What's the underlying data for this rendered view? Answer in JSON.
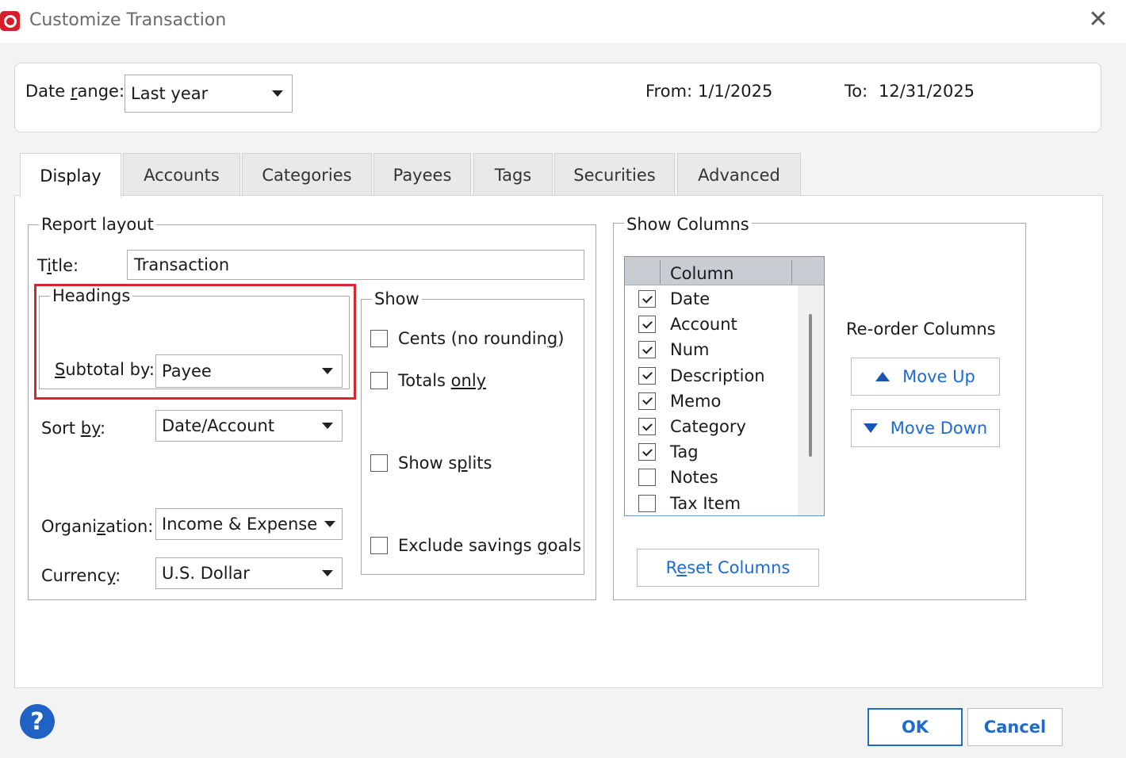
{
  "window": {
    "title": "Customize Transaction",
    "close_glyph": "✕"
  },
  "date_range": {
    "label_prefix": "Date ",
    "label_underlined": "r",
    "label_suffix": "ange:",
    "value": "Last year",
    "from_label": "From:",
    "from_value": "1/1/2025",
    "to_label": "To:",
    "to_value": "12/31/2025"
  },
  "tabs": [
    "Display",
    "Accounts",
    "Categories",
    "Payees",
    "Tags",
    "Securities",
    "Advanced"
  ],
  "report_layout": {
    "group_title": "Report layout",
    "title_label_prefix": "T",
    "title_label_underlined": "i",
    "title_label_suffix": "tle:",
    "title_value": "Transaction",
    "headings_title": "Headings",
    "subtotal_label_underlined": "S",
    "subtotal_label_suffix": "ubtotal by:",
    "subtotal_value": "Payee",
    "sort_label_prefix": "Sort ",
    "sort_label_underlined": "by",
    "sort_label_suffix": ":",
    "sort_value": "Date/Account",
    "org_label_prefix": "Organi",
    "org_label_underlined": "z",
    "org_label_suffix": "ation:",
    "org_value": "Income & Expense",
    "currency_label_prefix": "Currenc",
    "currency_label_underlined": "y",
    "currency_label_suffix": ":",
    "currency_value": "U.S. Dollar"
  },
  "show": {
    "group_title": "Show",
    "cents_prefix": "Cents (no roundin",
    "cents_underlined": "g",
    "cents_suffix": ")",
    "totals_prefix": "Totals ",
    "totals_underlined": "only",
    "splits_prefix": "Show s",
    "splits_underlined": "p",
    "splits_suffix": "lits",
    "savings_prefix": "Exclude savings ",
    "savings_underlined": "g",
    "savings_suffix": "oals"
  },
  "show_columns": {
    "group_title": "Show Columns",
    "header": "Column",
    "rows": [
      {
        "name": "Date",
        "checked": true
      },
      {
        "name": "Account",
        "checked": true
      },
      {
        "name": "Num",
        "checked": true
      },
      {
        "name": "Description",
        "checked": true
      },
      {
        "name": "Memo",
        "checked": true
      },
      {
        "name": "Category",
        "checked": true
      },
      {
        "name": "Tag",
        "checked": true
      },
      {
        "name": "Notes",
        "checked": false
      },
      {
        "name": "Tax Item",
        "checked": false
      }
    ],
    "reorder_label": "Re-order Columns",
    "move_up": "Move Up",
    "move_down": "Move Down",
    "reset_prefix": "R",
    "reset_underlined": "e",
    "reset_suffix": "set Columns"
  },
  "footer": {
    "help_glyph": "?",
    "ok": "OK",
    "cancel": "Cancel"
  },
  "colors": {
    "accent_blue": "#1d6ad1",
    "highlight_red": "#d9232d",
    "brand_red": "#d71e28"
  }
}
